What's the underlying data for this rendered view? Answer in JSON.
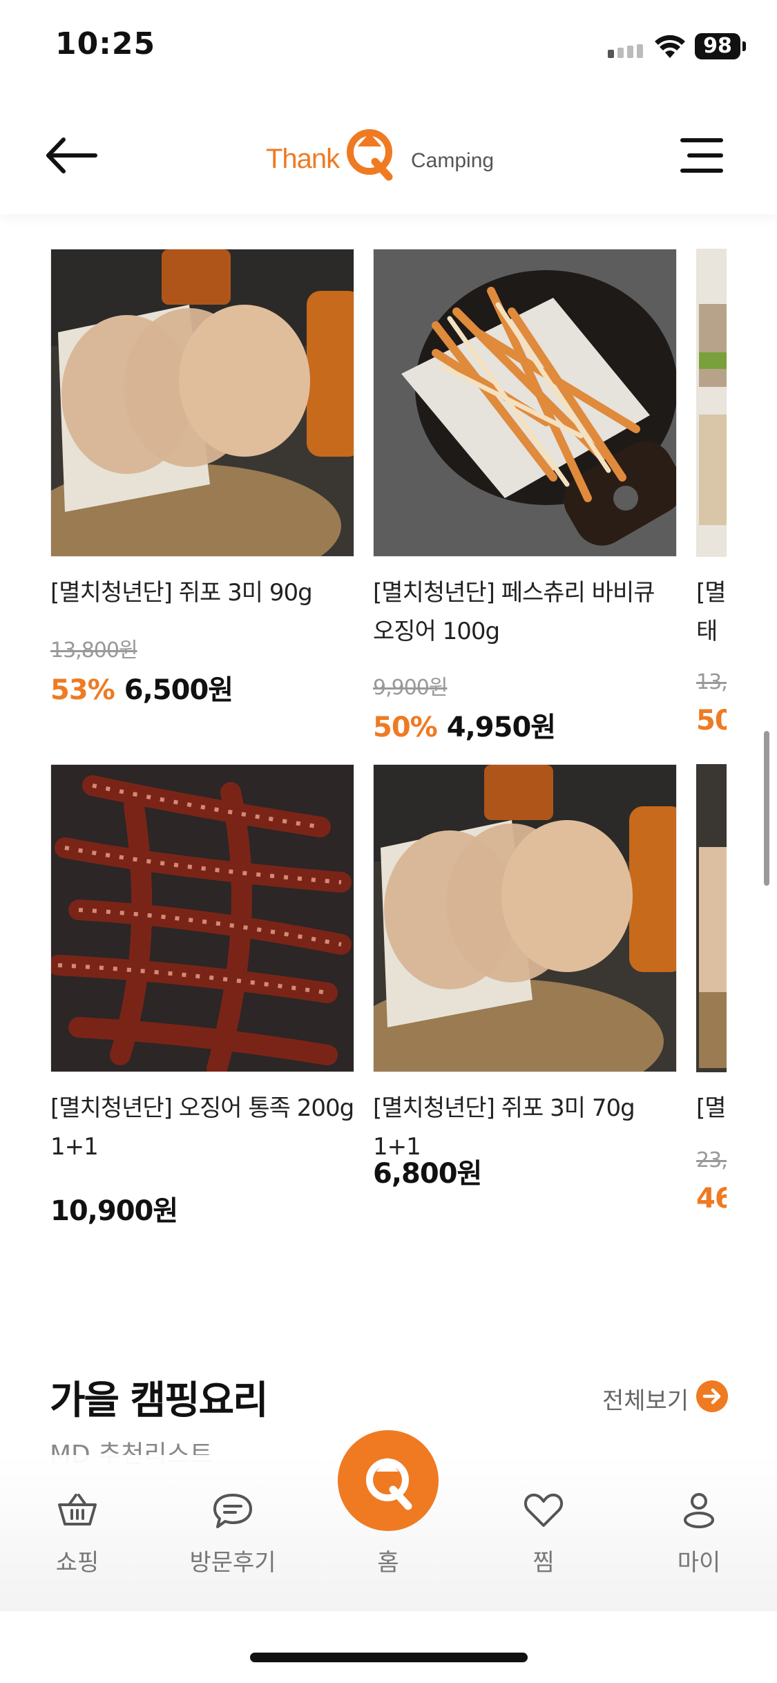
{
  "status_bar": {
    "time": "10:25",
    "battery": "98"
  },
  "header": {
    "logo_thank": "Thank",
    "logo_camping": "Camping"
  },
  "products": [
    {
      "name": "[멸치청년단] 쥐포 3미 90g",
      "original_price": "13,800원",
      "discount": "53%",
      "price": "6,500원"
    },
    {
      "name": "[멸치청년단] 페스츄리 바비큐\n오징어 100g",
      "original_price": "9,900원",
      "discount": "50%",
      "price": "4,950원"
    },
    {
      "name": "[멸치청년단] 오징어 통족 200g\n1+1",
      "original_price": "",
      "discount": "",
      "price": "10,900원"
    },
    {
      "name": "[멸치청년단] 쥐포 3미 70g 1+1",
      "original_price": "",
      "discount": "",
      "price": "6,800원"
    }
  ],
  "partial_products": [
    {
      "name": "[멸\n태",
      "original_price": "13,",
      "discount": "50"
    },
    {
      "name": "[멸",
      "original_price": "23,",
      "discount": "46"
    }
  ],
  "section": {
    "title": "가을 캠핑요리",
    "subtitle": "MD 추천리스트",
    "view_all": "전체보기"
  },
  "bottom_nav": {
    "items": [
      {
        "label": "쇼핑",
        "icon": "basket-icon"
      },
      {
        "label": "방문후기",
        "icon": "chat-bubble-icon"
      },
      {
        "label": "홈",
        "icon": "q-logo-icon"
      },
      {
        "label": "찜",
        "icon": "heart-icon"
      },
      {
        "label": "마이",
        "icon": "person-icon"
      }
    ]
  },
  "colors": {
    "accent": "#ef7a22",
    "text": "#111111",
    "muted": "#999999"
  }
}
